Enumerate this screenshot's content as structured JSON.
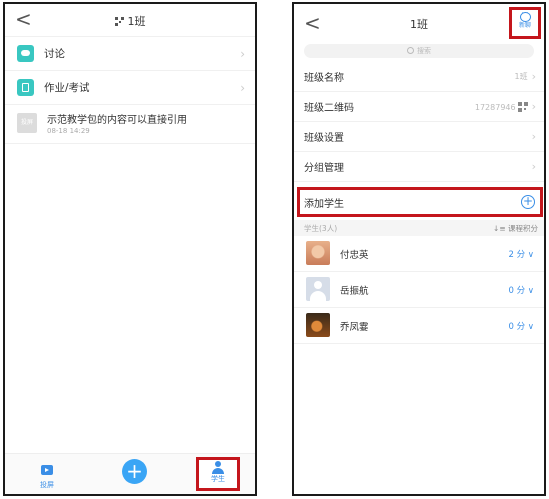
{
  "left": {
    "title": "1班",
    "back_glyph": "<",
    "rows": [
      {
        "label": "讨论",
        "icon": "discuss-icon"
      },
      {
        "label": "作业/考试",
        "icon": "homework-icon"
      }
    ],
    "resource": {
      "thumb_text": "投屏",
      "title": "示范教学包的内容可以直接引用",
      "time": "08-18 14:29"
    },
    "tabbar": {
      "cast_label": "投屏",
      "add_glyph": "+",
      "student_label": "学生"
    }
  },
  "right": {
    "title": "1班",
    "back_glyph": "<",
    "new_label": "新聊",
    "search_placeholder": "搜索",
    "settings": [
      {
        "label": "班级名称",
        "value": "1班"
      },
      {
        "label": "班级二维码",
        "value": "17287946"
      },
      {
        "label": "班级设置",
        "value": ""
      },
      {
        "label": "分组管理",
        "value": ""
      }
    ],
    "add_student_label": "添加学生",
    "section": {
      "left": "学生(3人)",
      "right": "↓≡ 课程积分"
    },
    "students": [
      {
        "name": "付忠英",
        "score": "2 分 ∨"
      },
      {
        "name": "岳振航",
        "score": "0 分 ∨"
      },
      {
        "name": "乔凤霎",
        "score": "0 分 ∨"
      }
    ]
  },
  "colors": {
    "accent": "#3a8ee6",
    "highlight": "#c4161c",
    "teal": "#39c7c1"
  }
}
